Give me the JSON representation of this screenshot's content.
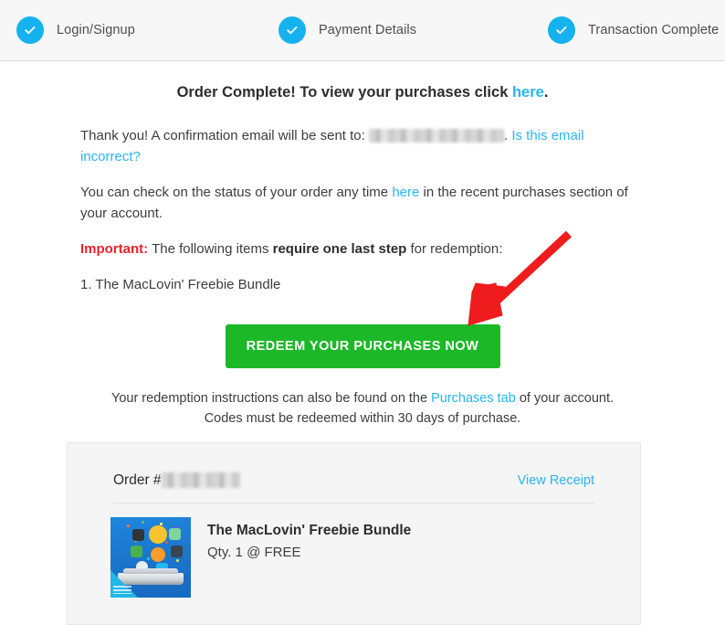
{
  "steps": {
    "items": [
      {
        "label": "Login/Signup",
        "icon": "check-icon",
        "complete": true
      },
      {
        "label": "Payment Details",
        "icon": "check-icon",
        "complete": true
      },
      {
        "label": "Transaction Complete",
        "icon": "check-icon",
        "complete": true
      }
    ],
    "circle_color": "#16b2f0"
  },
  "main": {
    "headline_before": "Order Complete! To view your purchases click ",
    "headline_link": "here",
    "headline_after": ".",
    "thankyou_before": "Thank you! A confirmation email will be sent to: ",
    "thankyou_email": "[redacted]",
    "thankyou_after": ". ",
    "thankyou_link": "Is this email incorrect?",
    "status_before": "You can check on the status of your order any time ",
    "status_link": "here",
    "status_after": " in the recent purchases section of your account.",
    "important_label": "Important:",
    "important_before": " The following items ",
    "important_strong": "require one last step",
    "important_after": " for redemption:",
    "item_list": [
      "1. The MacLovin' Freebie Bundle"
    ],
    "redeem_button": "REDEEM YOUR PURCHASES NOW",
    "subnote_before": "Your redemption instructions can also be found on the ",
    "subnote_link": "Purchases tab",
    "subnote_after": " of your account.",
    "subnote_line2": "Codes must be redeemed within 30 days of purchase."
  },
  "receipt": {
    "order_label": "Order #",
    "order_number": "[redacted]",
    "view_receipt": "View Receipt",
    "item": {
      "title": "The MacLovin' Freebie Bundle",
      "qty": "Qty. 1 @ FREE",
      "thumbnail": "maclovin-bundle-thumbnail"
    }
  },
  "annotation": {
    "arrow": "red-arrow-pointing-to-redeem-button",
    "color": "#ee1c1c"
  },
  "colors": {
    "accent_blue": "#29b5f2",
    "step_blue": "#16b2f0",
    "button_green": "#1cb828",
    "important_red": "#e8232a",
    "arrow_red": "#ee1c1c",
    "header_bg": "#f7f7f7",
    "panel_bg": "#f5f5f5"
  }
}
